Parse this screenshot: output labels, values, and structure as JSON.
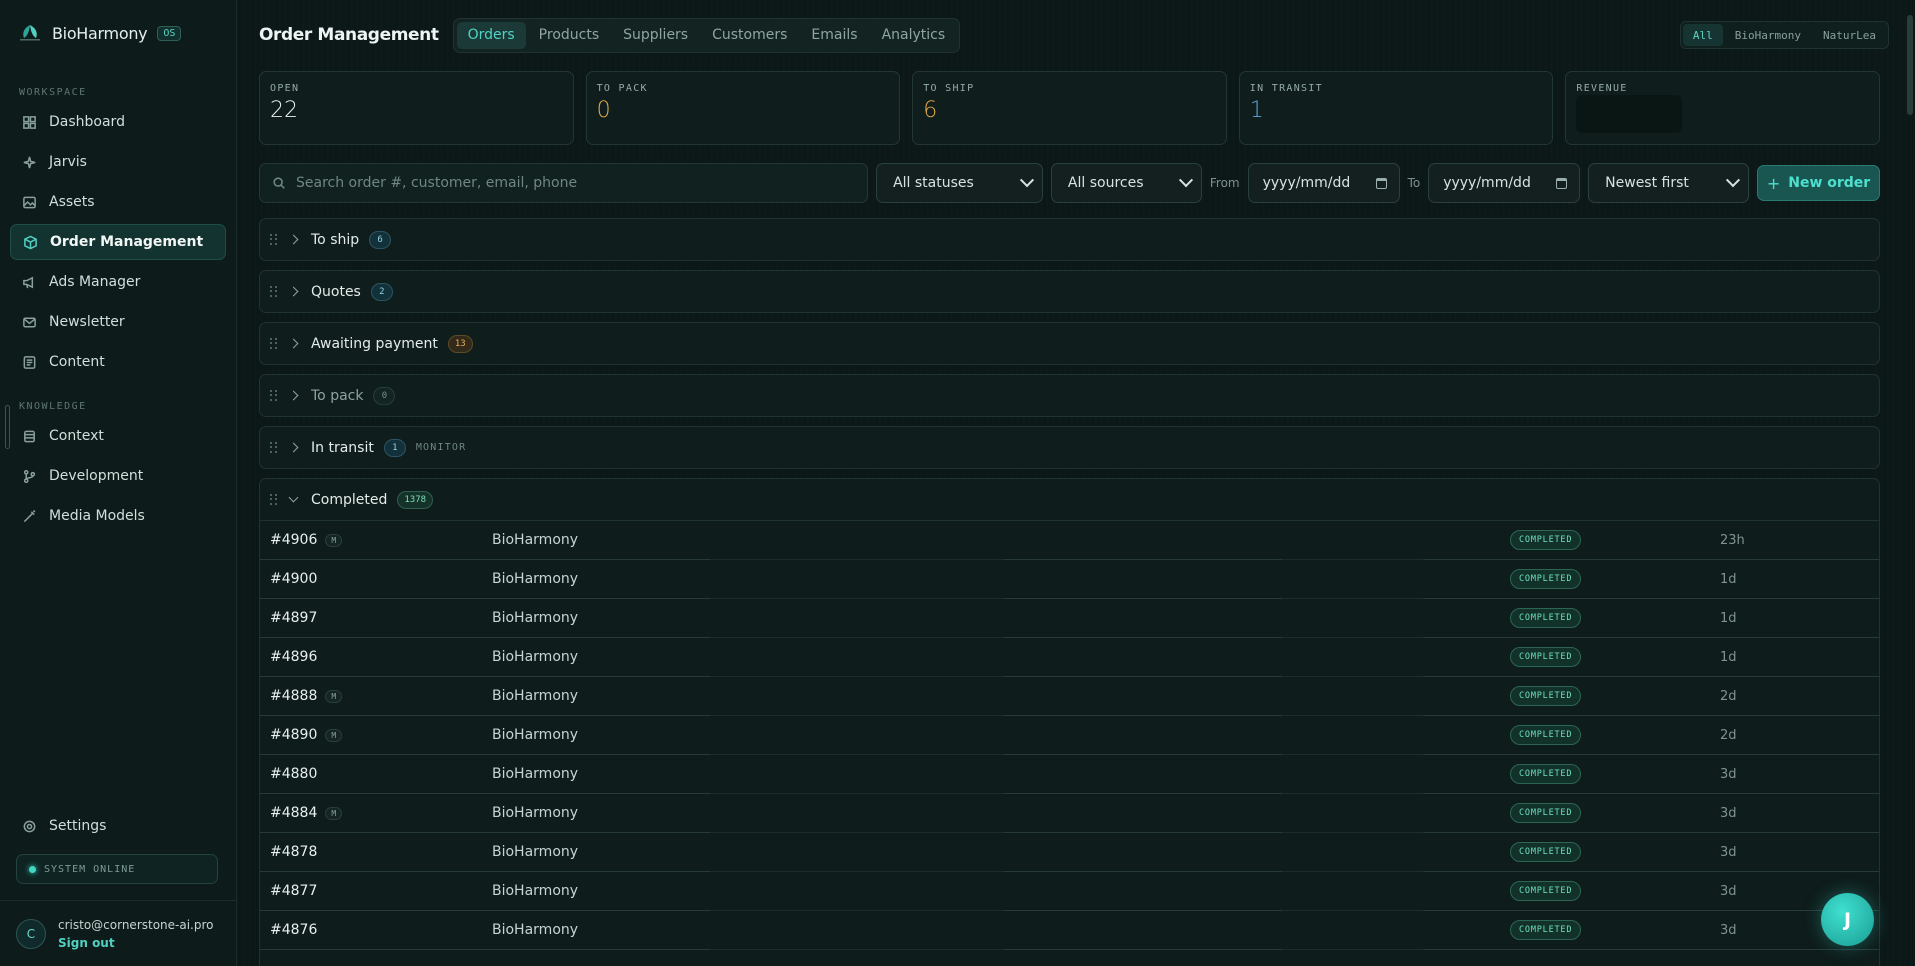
{
  "brand": {
    "name": "BioHarmony",
    "badge": "OS"
  },
  "sidebar": {
    "workspace_label": "WORKSPACE",
    "workspace_items": [
      {
        "label": "Dashboard",
        "icon": "grid-icon"
      },
      {
        "label": "Jarvis",
        "icon": "sparkle-icon"
      },
      {
        "label": "Assets",
        "icon": "image-icon"
      },
      {
        "label": "Order Management",
        "icon": "box-icon",
        "active": true
      },
      {
        "label": "Ads Manager",
        "icon": "megaphone-icon"
      },
      {
        "label": "Newsletter",
        "icon": "mail-icon"
      },
      {
        "label": "Content",
        "icon": "document-icon"
      }
    ],
    "knowledge_label": "KNOWLEDGE",
    "knowledge_items": [
      {
        "label": "Context",
        "icon": "database-icon"
      },
      {
        "label": "Development",
        "icon": "git-branch-icon"
      },
      {
        "label": "Media Models",
        "icon": "wand-icon"
      }
    ],
    "settings_label": "Settings",
    "system_status": "SYSTEM ONLINE",
    "user": {
      "initial": "C",
      "email": "cristo@cornerstone-ai.pro",
      "signout": "Sign out"
    }
  },
  "header": {
    "title": "Order Management",
    "tabs": [
      "Orders",
      "Products",
      "Suppliers",
      "Customers",
      "Emails",
      "Analytics"
    ],
    "active_tab": "Orders",
    "stores": [
      "All",
      "BioHarmony",
      "NaturLea"
    ],
    "active_store": "All"
  },
  "stats": [
    {
      "label": "OPEN",
      "value": "22"
    },
    {
      "label": "TO PACK",
      "value": "0"
    },
    {
      "label": "TO SHIP",
      "value": "6"
    },
    {
      "label": "IN TRANSIT",
      "value": "1"
    },
    {
      "label": "REVENUE",
      "value": ""
    }
  ],
  "filters": {
    "search_placeholder": "Search order #, customer, email, phone",
    "status_select": "All statuses",
    "source_select": "All sources",
    "from_label": "From",
    "from_value": "yyyy/mm/dd",
    "to_label": "To",
    "to_value": "yyyy/mm/dd",
    "sort_select": "Newest first",
    "new_order_label": "New order"
  },
  "groups": [
    {
      "title": "To ship",
      "count": "6"
    },
    {
      "title": "Quotes",
      "count": "2"
    },
    {
      "title": "Awaiting payment",
      "count": "13"
    },
    {
      "title": "To pack",
      "count": "0"
    },
    {
      "title": "In transit",
      "count": "1",
      "tag": "MONITOR"
    }
  ],
  "completed": {
    "title": "Completed",
    "count": "1378",
    "rows": [
      {
        "order": "#4906",
        "m": "M",
        "store": "BioHarmony",
        "status": "COMPLETED",
        "ago": "23h"
      },
      {
        "order": "#4900",
        "m": "",
        "store": "BioHarmony",
        "status": "COMPLETED",
        "ago": "1d"
      },
      {
        "order": "#4897",
        "m": "",
        "store": "BioHarmony",
        "status": "COMPLETED",
        "ago": "1d"
      },
      {
        "order": "#4896",
        "m": "",
        "store": "BioHarmony",
        "status": "COMPLETED",
        "ago": "1d"
      },
      {
        "order": "#4888",
        "m": "M",
        "store": "BioHarmony",
        "status": "COMPLETED",
        "ago": "2d"
      },
      {
        "order": "#4890",
        "m": "M",
        "store": "BioHarmony",
        "status": "COMPLETED",
        "ago": "2d"
      },
      {
        "order": "#4880",
        "m": "",
        "store": "BioHarmony",
        "status": "COMPLETED",
        "ago": "3d"
      },
      {
        "order": "#4884",
        "m": "M",
        "store": "BioHarmony",
        "status": "COMPLETED",
        "ago": "3d"
      },
      {
        "order": "#4878",
        "m": "",
        "store": "BioHarmony",
        "status": "COMPLETED",
        "ago": "3d"
      },
      {
        "order": "#4877",
        "m": "",
        "store": "BioHarmony",
        "status": "COMPLETED",
        "ago": "3d"
      },
      {
        "order": "#4876",
        "m": "",
        "store": "BioHarmony",
        "status": "COMPLETED",
        "ago": "3d"
      }
    ]
  },
  "assistant": {
    "initial": "J"
  }
}
